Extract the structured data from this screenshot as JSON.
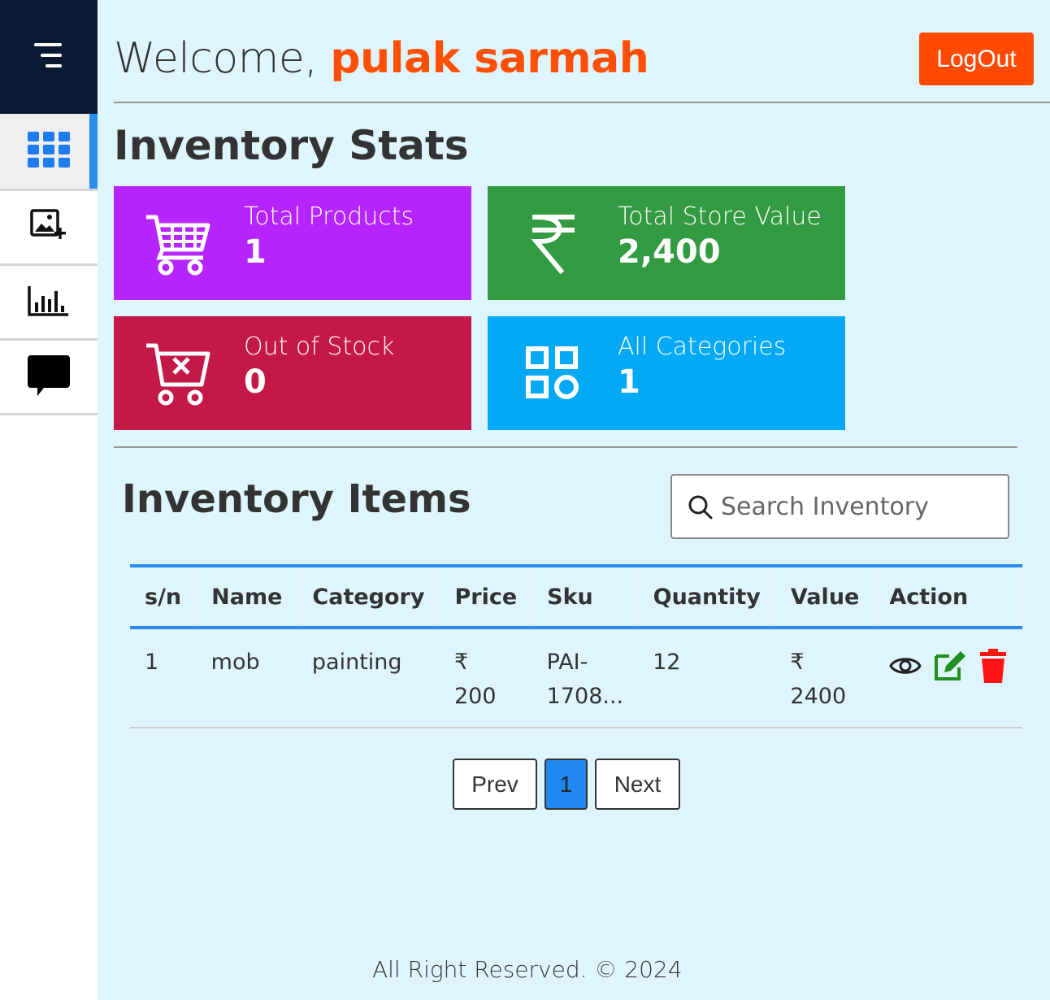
{
  "header": {
    "welcome_prefix": "Welcome, ",
    "username": "pulak sarmah",
    "logout_label": "LogOut"
  },
  "sidebar": {
    "items": [
      {
        "icon": "grid-icon",
        "active": true
      },
      {
        "icon": "add-image-icon",
        "active": false
      },
      {
        "icon": "bar-chart-icon",
        "active": false
      },
      {
        "icon": "chat-icon",
        "active": false
      }
    ]
  },
  "stats": {
    "title": "Inventory Stats",
    "cards": [
      {
        "label": "Total Products",
        "value": "1",
        "color": "#b624ff",
        "icon": "cart-icon"
      },
      {
        "label": "Total Store Value",
        "value": "2,400",
        "color": "#329a40",
        "icon": "rupee-icon"
      },
      {
        "label": "Out of Stock",
        "value": "0",
        "color": "#c41849",
        "icon": "cart-remove-icon"
      },
      {
        "label": "All Categories",
        "value": "1",
        "color": "#03a9f4",
        "icon": "categories-icon"
      }
    ]
  },
  "inventory": {
    "title": "Inventory Items",
    "search_placeholder": "Search Inventory",
    "columns": [
      "s/n",
      "Name",
      "Category",
      "Price",
      "Sku",
      "Quantity",
      "Value",
      "Action"
    ],
    "rows": [
      {
        "sn": "1",
        "name": "mob",
        "category": "painting",
        "price_symbol": "₹",
        "price": "200",
        "sku_line1": "PAI-",
        "sku_line2": "1708...",
        "quantity": "12",
        "value_symbol": "₹",
        "value": "2400"
      }
    ]
  },
  "pagination": {
    "prev_label": "Prev",
    "current_page": "1",
    "next_label": "Next"
  },
  "footer": {
    "text": "All Right Reserved. © 2024"
  },
  "colors": {
    "accent": "#2b8cf0",
    "logout": "#ff4a05",
    "username": "#ff4f05",
    "sidebar_top": "#0b1a33",
    "edit": "#1f8f1f",
    "delete": "#ff1414"
  }
}
